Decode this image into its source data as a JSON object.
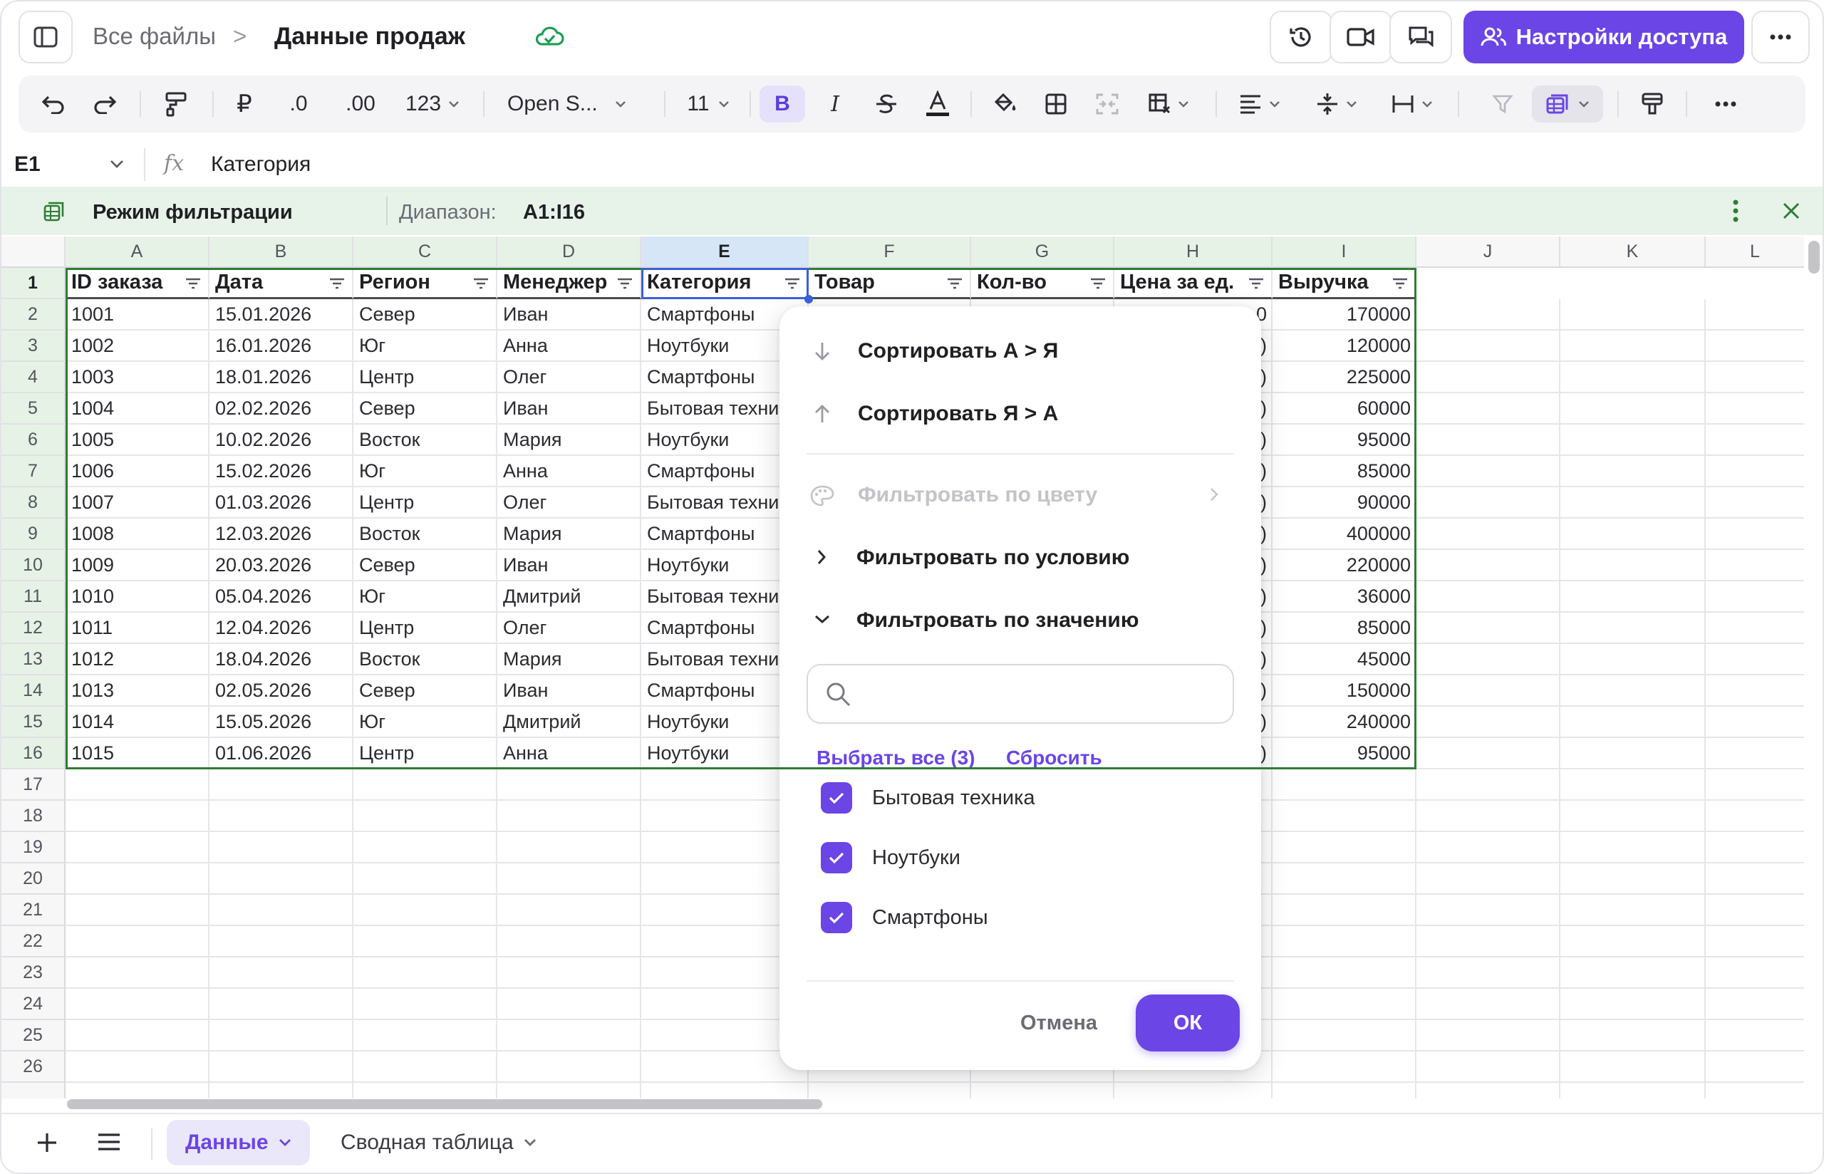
{
  "breadcrumb": {
    "root": "Все файлы",
    "separator": ">",
    "current": "Данные продаж"
  },
  "header": {
    "share_label": "Настройки доступа"
  },
  "toolbar": {
    "currency": "₽",
    "decrease_decimals": ".0",
    "increase_decimals": ".00",
    "number_format": "123",
    "font_family": "Open S...",
    "font_size": "11",
    "bold": "B",
    "italic": "I"
  },
  "formula_bar": {
    "cell_ref": "E1",
    "fx": "fx",
    "value": "Категория"
  },
  "filter_banner": {
    "title": "Режим фильтрации",
    "range_label": "Диапазон:",
    "range_value": "A1:I16"
  },
  "columns": [
    "A",
    "B",
    "C",
    "D",
    "E",
    "F",
    "G",
    "H",
    "I",
    "J",
    "K",
    "L"
  ],
  "rows": [
    "1",
    "2",
    "3",
    "4",
    "5",
    "6",
    "7",
    "8",
    "9",
    "10",
    "11",
    "12",
    "13",
    "14",
    "15",
    "16",
    "17",
    "18",
    "19",
    "20",
    "21",
    "22",
    "23",
    "24",
    "25",
    "26"
  ],
  "table": {
    "headers": [
      "ID заказа",
      "Дата",
      "Регион",
      "Менеджер",
      "Категория",
      "Товар",
      "Кол-во",
      "Цена за ед.",
      "Выручка"
    ],
    "rows": [
      [
        "1001",
        "15.01.2026",
        "Север",
        "Иван",
        "Смартфоны",
        "170000"
      ],
      [
        "1002",
        "16.01.2026",
        "Юг",
        "Анна",
        "Ноутбуки",
        "120000"
      ],
      [
        "1003",
        "18.01.2026",
        "Центр",
        "Олег",
        "Смартфоны",
        "225000"
      ],
      [
        "1004",
        "02.02.2026",
        "Север",
        "Иван",
        "Бытовая техни",
        "60000"
      ],
      [
        "1005",
        "10.02.2026",
        "Восток",
        "Мария",
        "Ноутбуки",
        "95000"
      ],
      [
        "1006",
        "15.02.2026",
        "Юг",
        "Анна",
        "Смартфоны",
        "85000"
      ],
      [
        "1007",
        "01.03.2026",
        "Центр",
        "Олег",
        "Бытовая техни",
        "90000"
      ],
      [
        "1008",
        "12.03.2026",
        "Восток",
        "Мария",
        "Смартфоны",
        "400000"
      ],
      [
        "1009",
        "20.03.2026",
        "Север",
        "Иван",
        "Ноутбуки",
        "220000"
      ],
      [
        "1010",
        "05.04.2026",
        "Юг",
        "Дмитрий",
        "Бытовая техни",
        "36000"
      ],
      [
        "1011",
        "12.04.2026",
        "Центр",
        "Олег",
        "Смартфоны",
        "85000"
      ],
      [
        "1012",
        "18.04.2026",
        "Восток",
        "Мария",
        "Бытовая техни",
        "45000"
      ],
      [
        "1013",
        "02.05.2026",
        "Север",
        "Иван",
        "Смартфоны",
        "150000"
      ],
      [
        "1014",
        "15.05.2026",
        "Юг",
        "Дмитрий",
        "Ноутбуки",
        "240000"
      ],
      [
        "1015",
        "01.06.2026",
        "Центр",
        "Анна",
        "Ноутбуки",
        "95000"
      ]
    ],
    "partial_h_first": "0",
    "partial_h_rest": ")"
  },
  "filter_menu": {
    "sort_asc": "Сортировать А > Я",
    "sort_desc": "Сортировать Я > А",
    "filter_color": "Фильтровать по цвету",
    "filter_condition": "Фильтровать по условию",
    "filter_value": "Фильтровать по значению",
    "search_placeholder": "",
    "select_all": "Выбрать все (3)",
    "reset": "Сбросить",
    "options": [
      {
        "label": "Бытовая техника",
        "checked": true
      },
      {
        "label": "Ноутбуки",
        "checked": true
      },
      {
        "label": "Смартфоны",
        "checked": true
      }
    ],
    "cancel": "Отмена",
    "ok": "ОК"
  },
  "sheets": [
    {
      "label": "Данные",
      "active": true
    },
    {
      "label": "Сводная таблица",
      "active": false
    }
  ],
  "colors": {
    "accent": "#6b45e6",
    "range_highlight": "#e7f3e8",
    "range_border": "#2e7d32",
    "selection": "#3b5fd9"
  }
}
